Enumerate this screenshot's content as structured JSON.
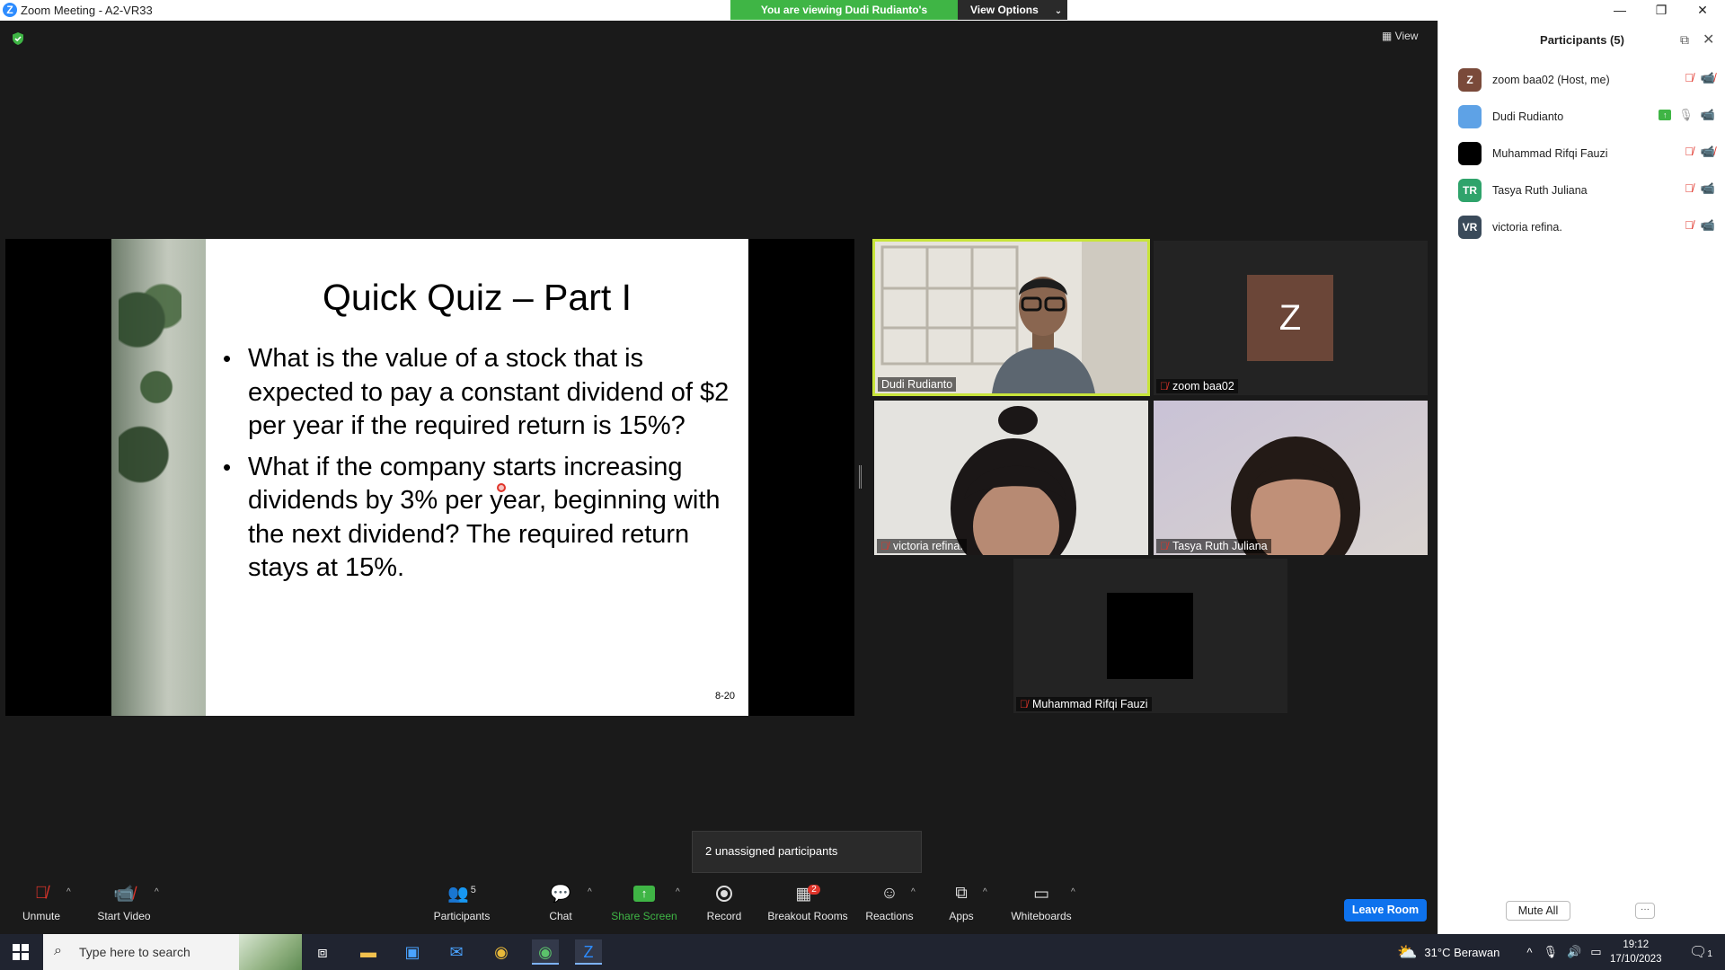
{
  "window": {
    "title": "Zoom Meeting - A2-VR33",
    "minimize": "—",
    "restore": "❐",
    "close": "✕"
  },
  "banner": {
    "viewing": "You are viewing Dudi Rudianto's screen",
    "options": "View Options"
  },
  "view_button": "View",
  "slide": {
    "title": "Quick Quiz – Part I",
    "bullets": [
      "What is the value of a stock that is expected to pay a constant dividend of $2 per year if the required return is 15%?",
      "What if the company starts increasing dividends by 3% per year, beginning with the next dividend? The required return stays at 15%."
    ],
    "page_number": "8-20"
  },
  "tiles": {
    "dudi": "Dudi Rudianto",
    "zoom": "zoom baa02",
    "zoom_initial": "Z",
    "victoria": "victoria refina.",
    "tasya": "Tasya Ruth Juliana",
    "muhammad": "Muhammad Rifqi Fauzi"
  },
  "popup": "2 unassigned participants",
  "toolbar": {
    "unmute": "Unmute",
    "start_video": "Start Video",
    "participants": "Participants",
    "participants_count": "5",
    "chat": "Chat",
    "share_screen": "Share Screen",
    "record": "Record",
    "breakout_rooms": "Breakout Rooms",
    "breakout_badge": "2",
    "reactions": "Reactions",
    "apps": "Apps",
    "whiteboards": "Whiteboards",
    "leave_room": "Leave Room"
  },
  "panel": {
    "title": "Participants (5)",
    "participants": [
      {
        "initials": "Z",
        "name": "zoom baa02 (Host, me)",
        "color": "#7a4a3a"
      },
      {
        "initials": "",
        "name": "Dudi Rudianto",
        "color": "#5ea2e6"
      },
      {
        "initials": "",
        "name": "Muhammad Rifqi Fauzi",
        "color": "#000000"
      },
      {
        "initials": "TR",
        "name": "Tasya Ruth Juliana",
        "color": "#2fa36b"
      },
      {
        "initials": "VR",
        "name": "victoria refina.",
        "color": "#3a4a5a"
      }
    ],
    "mute_all": "Mute All",
    "more": "···"
  },
  "taskbar": {
    "search_placeholder": "Type here to search",
    "weather": "31°C  Berawan",
    "time": "19:12",
    "date": "17/10/2023",
    "notification_count": "1"
  },
  "colors": {
    "accent_blue": "#0e72ed",
    "active_speaker": "#c8e43a",
    "banner_green": "#3fb545",
    "muted_red": "#e0352b"
  }
}
